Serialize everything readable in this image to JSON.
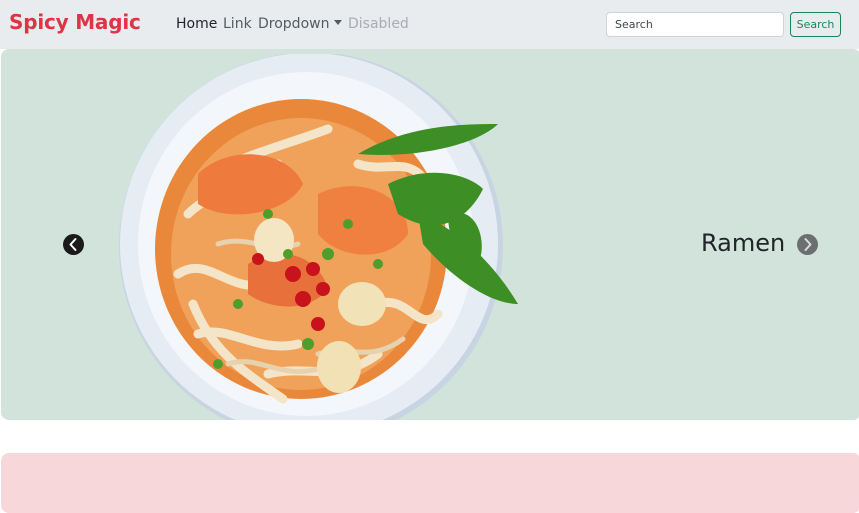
{
  "navbar": {
    "brand": "Spicy Magic",
    "links": [
      {
        "label": "Home",
        "state": "active"
      },
      {
        "label": "Link",
        "state": "default"
      },
      {
        "label": "Dropdown",
        "state": "dropdown"
      },
      {
        "label": "Disabled",
        "state": "disabled"
      }
    ],
    "search": {
      "placeholder": "Search",
      "value": "",
      "button_label": "Search"
    }
  },
  "carousel": {
    "slide_title": "Ramen",
    "prev_icon": "chevron-left-icon",
    "next_icon": "chevron-right-icon"
  },
  "colors": {
    "brand": "#dc3545",
    "navbar_bg": "#e9ecef",
    "carousel_bg": "#d1e3da",
    "success": "#198754",
    "danger_light": "#f8d7da"
  }
}
